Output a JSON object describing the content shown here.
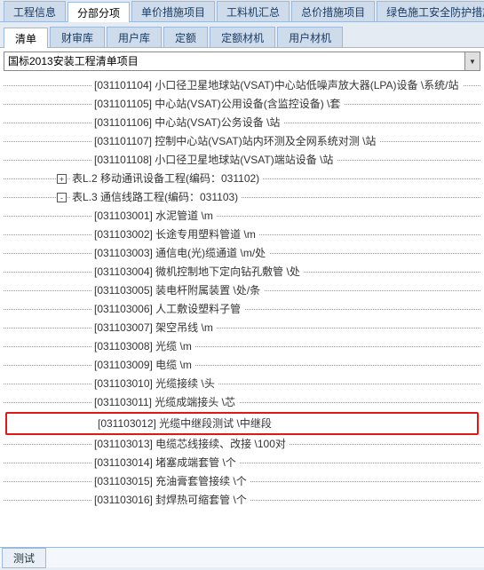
{
  "mainTabs": {
    "items": [
      "工程信息",
      "分部分项",
      "单价措施项目",
      "工料机汇总",
      "总价措施项目",
      "绿色施工安全防护措施"
    ],
    "activeIndex": 1
  },
  "subTabs": {
    "items": [
      "清单",
      "财审库",
      "用户库",
      "定额",
      "定额材机",
      "用户材机"
    ],
    "activeIndex": 0
  },
  "dropdown": {
    "value": "国标2013安装工程清单项目"
  },
  "treeRows": [
    {
      "indent": 100,
      "toggle": "",
      "text": "[031101104] 小口径卫星地球站(VSAT)中心站低噪声放大器(LPA)设备 \\系统/站"
    },
    {
      "indent": 100,
      "toggle": "",
      "text": "[031101105] 中心站(VSAT)公用设备(含监控设备) \\套"
    },
    {
      "indent": 100,
      "toggle": "",
      "text": "[031101106] 中心站(VSAT)公务设备 \\站"
    },
    {
      "indent": 100,
      "toggle": "",
      "text": "[031101107] 控制中心站(VSAT)站内环测及全网系统对测 \\站"
    },
    {
      "indent": 100,
      "toggle": "",
      "text": "[031101108] 小口径卫星地球站(VSAT)端站设备 \\站"
    },
    {
      "indent": 60,
      "toggle": "+",
      "text": "表L.2 移动通讯设备工程(编码：031102)"
    },
    {
      "indent": 60,
      "toggle": "-",
      "text": "表L.3 通信线路工程(编码：031103)"
    },
    {
      "indent": 100,
      "toggle": "",
      "text": "[031103001] 水泥管道 \\m"
    },
    {
      "indent": 100,
      "toggle": "",
      "text": "[031103002] 长途专用塑料管道 \\m"
    },
    {
      "indent": 100,
      "toggle": "",
      "text": "[031103003] 通信电(光)缆通道 \\m/处"
    },
    {
      "indent": 100,
      "toggle": "",
      "text": "[031103004] 微机控制地下定向钻孔敷管 \\处"
    },
    {
      "indent": 100,
      "toggle": "",
      "text": "[031103005] 装电杆附属装置 \\处/条"
    },
    {
      "indent": 100,
      "toggle": "",
      "text": "[031103006] 人工敷设塑料子管"
    },
    {
      "indent": 100,
      "toggle": "",
      "text": "[031103007] 架空吊线 \\m"
    },
    {
      "indent": 100,
      "toggle": "",
      "text": "[031103008] 光缆 \\m"
    },
    {
      "indent": 100,
      "toggle": "",
      "text": "[031103009] 电缆 \\m"
    },
    {
      "indent": 100,
      "toggle": "",
      "text": "[031103010] 光缆接续 \\头"
    },
    {
      "indent": 100,
      "toggle": "",
      "text": "[031103011] 光缆成端接头 \\芯"
    },
    {
      "indent": 100,
      "toggle": "",
      "text": "[031103012] 光缆中继段测试 \\中继段",
      "highlight": true
    },
    {
      "indent": 100,
      "toggle": "",
      "text": "[031103013] 电缆芯线接续、改接 \\100对"
    },
    {
      "indent": 100,
      "toggle": "",
      "text": "[031103014] 堵塞成端套管 \\个"
    },
    {
      "indent": 100,
      "toggle": "",
      "text": "[031103015] 充油膏套管接续 \\个"
    },
    {
      "indent": 100,
      "toggle": "",
      "text": "[031103016] 封焊热可缩套管 \\个"
    }
  ],
  "bottomLabel": "测试"
}
